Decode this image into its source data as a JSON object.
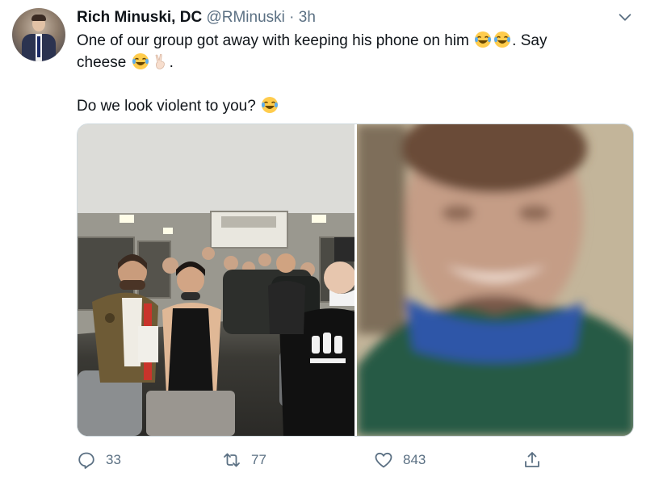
{
  "tweet": {
    "author_name": "Rich Minuski, DC",
    "handle": "@RMinuski",
    "separator": "·",
    "time": "3h",
    "text_line1": "One of our group got away with keeping his phone on him",
    "text_line1_end": ". Say",
    "text_line2": "cheese",
    "text_line2_end": ".",
    "text_line3": "Do we look violent to you?",
    "emojis": [
      "face-with-tears-of-joy",
      "face-with-tears-of-joy",
      "face-with-tears-of-joy",
      "victory-hand",
      "face-with-tears-of-joy"
    ]
  },
  "media": {
    "images": [
      {
        "name": "group-selfie-on-bus"
      },
      {
        "name": "zoomed-face-closeup"
      }
    ]
  },
  "actions": {
    "reply_count": "33",
    "retweet_count": "77",
    "like_count": "843"
  },
  "colors": {
    "secondary_text": "#5b7083",
    "primary_text": "#0f1419",
    "border": "#cfd9de"
  }
}
